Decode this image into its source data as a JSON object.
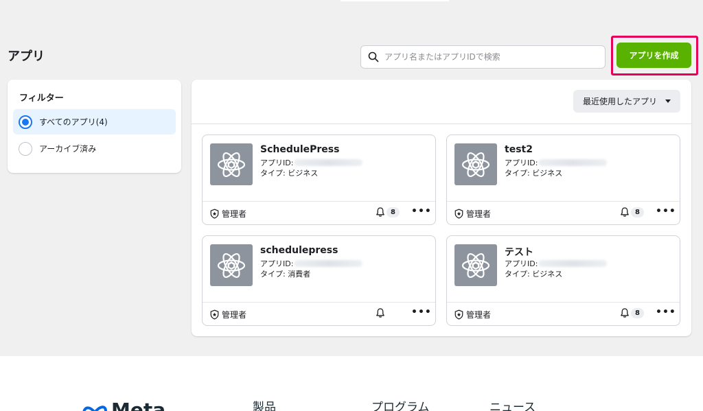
{
  "page": {
    "title": "アプリ"
  },
  "search": {
    "placeholder": "アプリ名またはアプリIDで検索"
  },
  "create_button": {
    "label": "アプリを作成",
    "color": "#59b200",
    "highlight_color": "#e6005a"
  },
  "filter": {
    "title": "フィルター",
    "options": [
      {
        "label": "すべてのアプリ(4)",
        "selected": true
      },
      {
        "label": "アーカイブ済み",
        "selected": false
      }
    ]
  },
  "sort": {
    "label": "最近使用したアプリ"
  },
  "apps": [
    {
      "name": "SchedulePress",
      "id_label": "アプリID:",
      "type": "タイプ: ビジネス",
      "role": "管理者",
      "notifications": "8"
    },
    {
      "name": "test2",
      "id_label": "アプリID:",
      "type": "タイプ: ビジネス",
      "role": "管理者",
      "notifications": "8"
    },
    {
      "name": "schedulepress",
      "id_label": "アプリID:",
      "type": "タイプ: 消費者",
      "role": "管理者",
      "notifications": ""
    },
    {
      "name": "テスト",
      "id_label": "アプリID:",
      "type": "タイプ: ビジネス",
      "role": "管理者",
      "notifications": "8"
    }
  ],
  "more_label": "•••",
  "footer": {
    "logo_text": "Meta",
    "columns": [
      "製品",
      "プログラム",
      "ニュース"
    ]
  }
}
